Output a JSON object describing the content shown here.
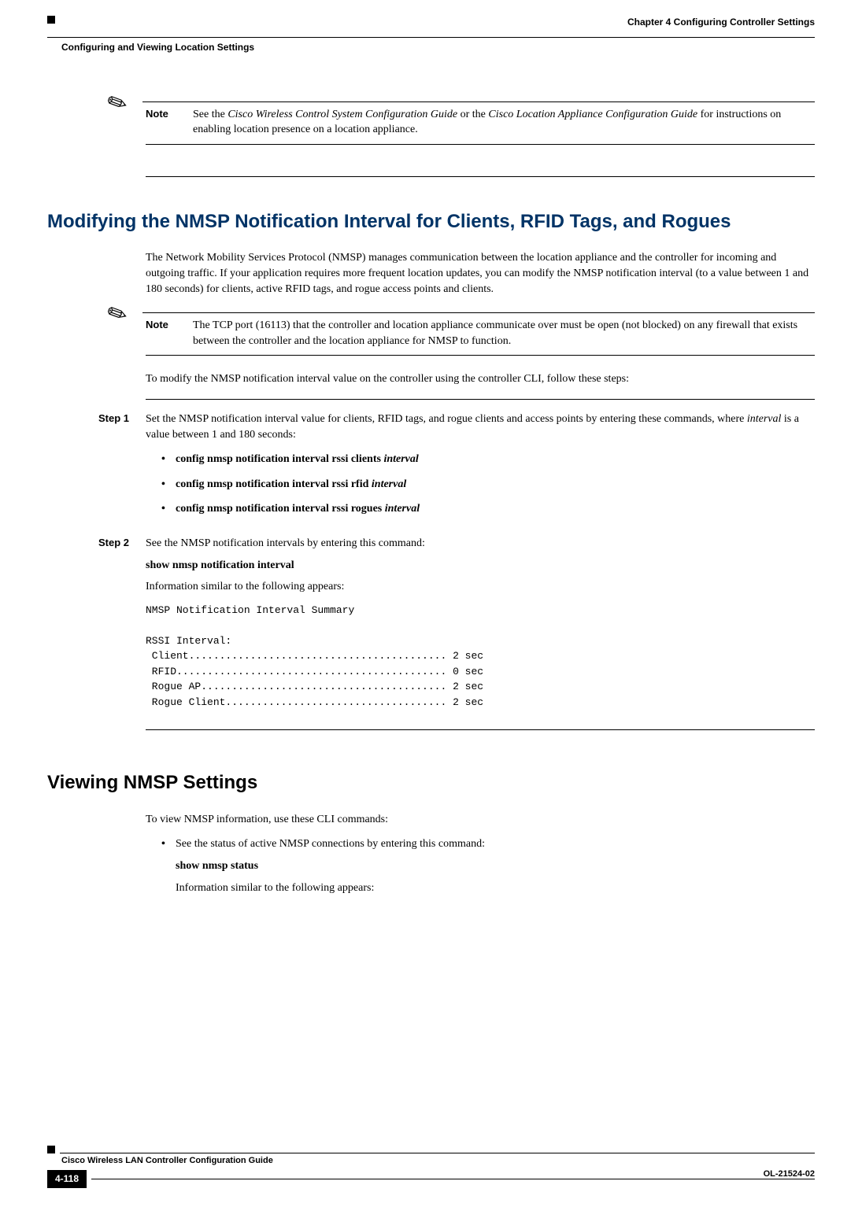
{
  "header": {
    "chapter_line": "Chapter 4      Configuring Controller Settings",
    "section_line": "Configuring and Viewing Location Settings"
  },
  "note1": {
    "label": "Note",
    "text_prefix": "See the ",
    "doc1": "Cisco Wireless Control System Configuration Guide",
    "mid": " or the ",
    "doc2": "Cisco Location Appliance Configuration Guide",
    "text_suffix": " for instructions on enabling location presence on a location appliance."
  },
  "section1": {
    "heading": "Modifying the NMSP Notification Interval for Clients, RFID Tags, and Rogues",
    "intro": "The Network Mobility Services Protocol (NMSP) manages communication between the location appliance and the controller for incoming and outgoing traffic. If your application requires more frequent location updates, you can modify the NMSP notification interval (to a value between 1 and 180 seconds) for clients, active RFID tags, and rogue access points and clients."
  },
  "note2": {
    "label": "Note",
    "text": "The TCP port (16113) that the controller and location appliance communicate over must be open (not blocked) on any firewall that exists between the controller and the location appliance for NMSP to function."
  },
  "para_followsteps": "To modify the NMSP notification interval value on the controller using the controller CLI, follow these steps:",
  "step1": {
    "label": "Step 1",
    "text_pre": "Set the NMSP notification interval value for clients, RFID tags, and rogue clients and access points by entering these commands, where ",
    "text_italic": "interval",
    "text_post": " is a value between 1 and 180 seconds:",
    "cmds": [
      {
        "bold": "config nmsp notification interval rssi clients ",
        "italic": "interval"
      },
      {
        "bold": "config nmsp notification interval rssi rfid ",
        "italic": "interval"
      },
      {
        "bold": "config nmsp notification interval rssi rogues ",
        "italic": "interval"
      }
    ]
  },
  "step2": {
    "label": "Step 2",
    "text": "See the NMSP notification intervals by entering this command:",
    "cmd": "show nmsp notification interval",
    "info": "Information similar to the following appears:",
    "output": "NMSP Notification Interval Summary\n\nRSSI Interval:\n Client.......................................... 2 sec\n RFID............................................ 0 sec\n Rogue AP........................................ 2 sec\n Rogue Client.................................... 2 sec"
  },
  "section2": {
    "heading": "Viewing NMSP Settings",
    "intro": "To view NMSP information, use these CLI commands:",
    "bullet1": "See the status of active NMSP connections by entering this command:",
    "cmd": "show nmsp status",
    "info": "Information similar to the following appears:"
  },
  "footer": {
    "title": "Cisco Wireless LAN Controller Configuration Guide",
    "page": "4-118",
    "docnum": "OL-21524-02"
  }
}
